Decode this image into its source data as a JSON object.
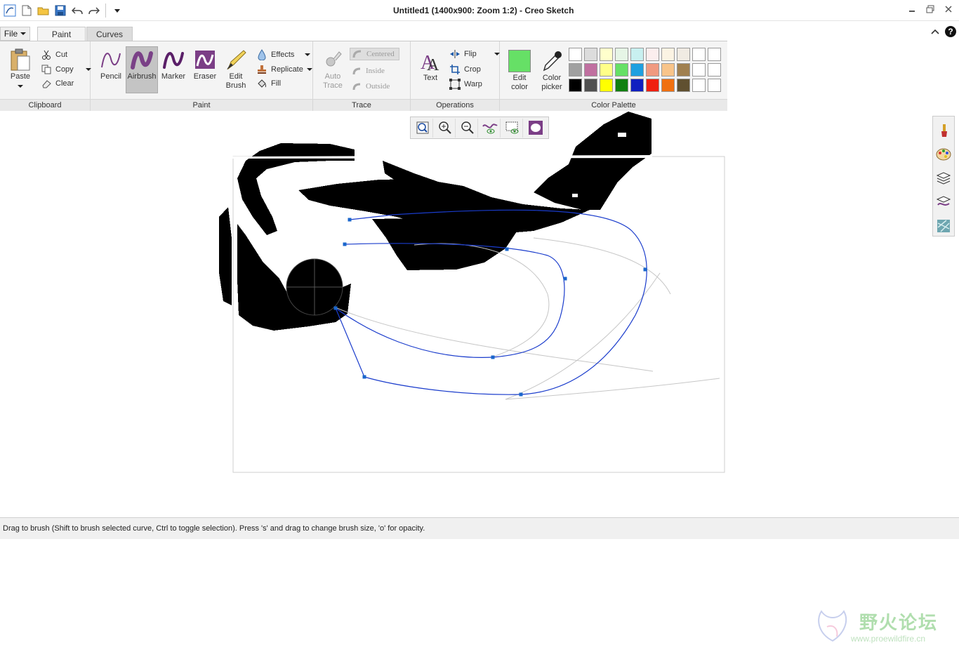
{
  "window": {
    "title": "Untitled1 (1400x900: Zoom 1:2) - Creo Sketch"
  },
  "qat": {
    "icons": [
      "app-icon",
      "new-icon",
      "open-icon",
      "save-icon",
      "undo-icon",
      "redo-icon",
      "customize-icon"
    ]
  },
  "menu": {
    "file_label": "File"
  },
  "tabs": [
    {
      "label": "Paint",
      "active": true
    },
    {
      "label": "Curves",
      "active": false
    }
  ],
  "ribbon": {
    "clipboard": {
      "group_label": "Clipboard",
      "paste": "Paste",
      "cut": "Cut",
      "copy": "Copy",
      "clear": "Clear"
    },
    "paint": {
      "group_label": "Paint",
      "pencil": "Pencil",
      "airbrush": "Airbrush",
      "marker": "Marker",
      "eraser": "Eraser",
      "edit_brush_1": "Edit",
      "edit_brush_2": "Brush",
      "effects": "Effects",
      "replicate": "Replicate",
      "fill": "Fill",
      "selected": "Airbrush"
    },
    "trace": {
      "group_label": "Trace",
      "auto_1": "Auto",
      "auto_2": "Trace",
      "centered": "Centered",
      "inside": "Inside",
      "outside": "Outside"
    },
    "operations": {
      "group_label": "Operations",
      "text": "Text",
      "flip": "Flip",
      "crop": "Crop",
      "warp": "Warp"
    },
    "palette": {
      "group_label": "Color Palette",
      "edit_color_1": "Edit",
      "edit_color_2": "color",
      "color_picker_1": "Color",
      "color_picker_2": "picker",
      "current_color": "#66e066",
      "swatches": [
        "#ffffff",
        "#dcdcdc",
        "#ffffcc",
        "#e6f5e6",
        "#c8f0f0",
        "#fbeeee",
        "#fbf3e3",
        "#f0ebe3",
        "#ffffff",
        "#ffffff",
        "#a0a0a0",
        "#c070a0",
        "#ffff88",
        "#66e066",
        "#1ea0e0",
        "#f09a80",
        "#f8c48a",
        "#a08050",
        "#ffffff",
        "#ffffff",
        "#000000",
        "#505050",
        "#ffff00",
        "#108010",
        "#1020c0",
        "#f02010",
        "#f07010",
        "#605030",
        "#ffffff",
        "#ffffff"
      ]
    }
  },
  "zoom_toolbar": {
    "icons": [
      "zoom-fit-icon",
      "zoom-in-icon",
      "zoom-out-icon",
      "curve-visibility-icon",
      "canvas-visibility-icon",
      "brush-shape-icon"
    ]
  },
  "right_panel": {
    "icons": [
      "brush-tool-icon",
      "palette-icon",
      "layers-icon",
      "curves-layer-icon",
      "texture-icon"
    ]
  },
  "watermark": {
    "text": "野火论坛",
    "url": "www.proewildfire.cn"
  },
  "status": {
    "text": "Drag to brush (Shift to brush selected curve, Ctrl to toggle selection).  Press 's' and drag to change brush size, 'o' for opacity."
  }
}
